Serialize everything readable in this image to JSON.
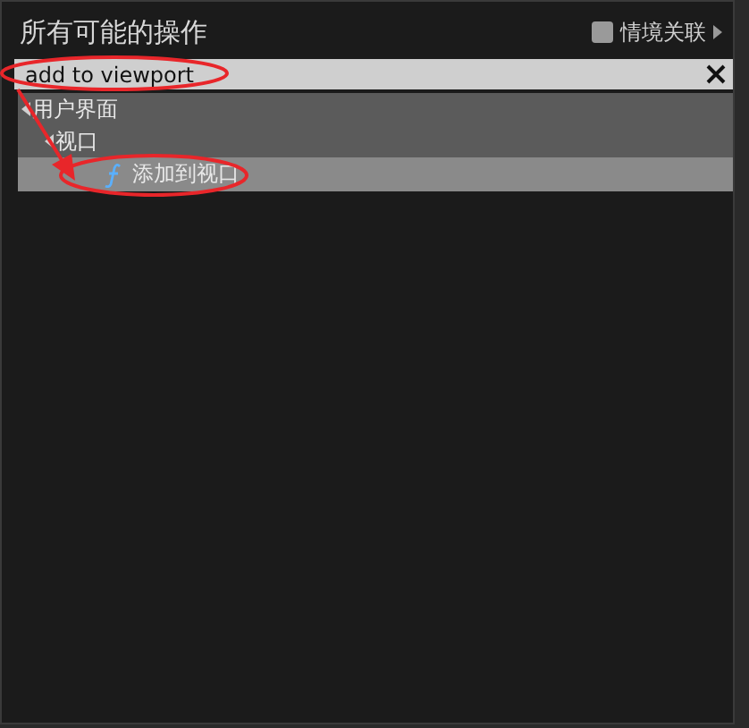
{
  "panel": {
    "title": "所有可能的操作",
    "context_sensitive": {
      "label": "情境关联",
      "checked": false
    }
  },
  "search": {
    "value": "add to viewport"
  },
  "tree": [
    {
      "label": "用户界面",
      "kind": "category",
      "expanded": true,
      "selected": false,
      "children": [
        {
          "label": "视口",
          "kind": "category",
          "expanded": true,
          "selected": false,
          "children": [
            {
              "label": "添加到视口",
              "kind": "function",
              "selected": true
            }
          ]
        }
      ]
    }
  ]
}
